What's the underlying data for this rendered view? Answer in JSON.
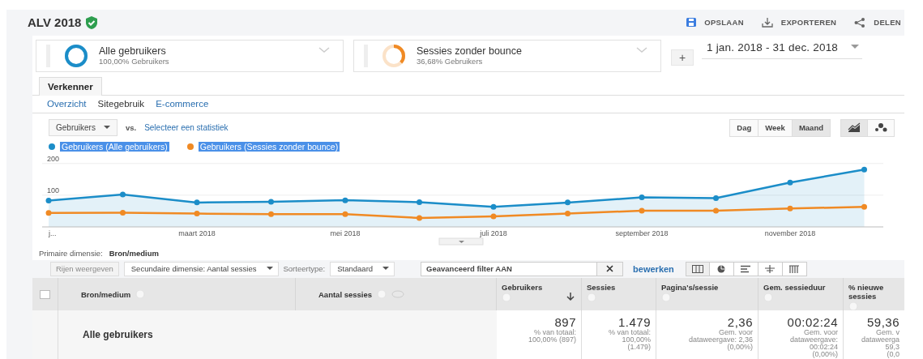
{
  "report": {
    "title": "ALV 2018",
    "verified": true
  },
  "actions": [
    {
      "label": "OPSLAAN",
      "kind": "save"
    },
    {
      "label": "EXPORTEREN",
      "kind": "export"
    },
    {
      "label": "DELEN",
      "kind": "share"
    }
  ],
  "segments": [
    {
      "name": "Alle gebruikers",
      "share": "100,00% Gebruikers",
      "level": 1.0,
      "color": "#1b8dc8"
    },
    {
      "name": "Sessies zonder bounce",
      "share": "36,68% Gebruikers",
      "level": 0.3668,
      "color": "#f08a24"
    }
  ],
  "add_segment": "+",
  "date_range": "1 jan. 2018 - 31 dec. 2018",
  "tabs": [
    {
      "label": "Verkenner",
      "selected": true
    }
  ],
  "subtabs": [
    {
      "label": "Overzicht",
      "selected": false
    },
    {
      "label": "Sitegebruik",
      "selected": true
    },
    {
      "label": "E-commerce",
      "selected": false
    }
  ],
  "metric_select": "Gebruikers",
  "vs": "vs.",
  "compare_link": "Selecteer een statistiek",
  "periods": [
    {
      "label": "Dag",
      "selected": false
    },
    {
      "label": "Week",
      "selected": false
    },
    {
      "label": "Maand",
      "selected": true
    }
  ],
  "chart_types": [
    {
      "kind": "line",
      "selected": true
    },
    {
      "kind": "motion",
      "selected": false
    }
  ],
  "chart_data": {
    "type": "area",
    "categories": [
      "j...",
      null,
      "maart 2018",
      null,
      "mei 2018",
      null,
      "juli 2018",
      null,
      "september 2018",
      null,
      "november 2018",
      null
    ],
    "ylim": [
      0,
      276
    ],
    "yticks": [
      100,
      200
    ],
    "series": [
      {
        "name": "Gebruikers (Alle gebruikers)",
        "color": "#1b8dc8",
        "marker": true,
        "values": [
          83,
          102,
          77,
          79,
          84,
          78,
          63,
          77,
          93,
          91,
          140,
          181
        ]
      },
      {
        "name": "Gebruikers (Sessies zonder bounce)",
        "color": "#f08a24",
        "type": "line",
        "marker": true,
        "values": [
          44,
          45,
          42,
          40,
          40,
          28,
          33,
          42,
          51,
          51,
          58,
          63
        ]
      }
    ]
  },
  "primary_dimension": {
    "label": "Primaire dimensie:",
    "value": "Bron/medium"
  },
  "toolbar": {
    "show_rows": {
      "label": "Rijen weergeven",
      "disabled": true
    },
    "secondary": "Secundaire dimensie: Aantal sessies",
    "sort_label": "Sorteertype:",
    "sort_value": "Standaard",
    "filter": "Geavanceerd filter AAN",
    "edit": "bewerken",
    "views": [
      {
        "kind": "table",
        "selected": true
      },
      {
        "kind": "pie",
        "selected": false
      },
      {
        "kind": "bar",
        "selected": false
      },
      {
        "kind": "comparison",
        "selected": false
      },
      {
        "kind": "pivot",
        "selected": false
      }
    ]
  },
  "table": {
    "select_all": {
      "checked": false
    },
    "columns": [
      {
        "label": "Bron/medium",
        "kind": "dimension",
        "help": true,
        "sorted": false
      },
      {
        "label": "Aantal sessies",
        "kind": "secondary",
        "help": true,
        "sorted": false
      },
      {
        "label": "Gebruikers",
        "kind": "metric",
        "help": true,
        "sorted": true
      },
      {
        "label": "Sessies",
        "kind": "metric",
        "help": true,
        "sorted": false
      },
      {
        "label": "Pagina's/sessie",
        "kind": "metric",
        "help": true,
        "sorted": false
      },
      {
        "label": "Gem. sessieduur",
        "kind": "metric",
        "help": true,
        "sorted": false
      },
      {
        "label": "% nieuwe sessies",
        "kind": "metric",
        "help": true,
        "sorted": false
      }
    ],
    "rows": [
      {
        "cells": [
          {
            "value": "Alle gebruikers"
          },
          {},
          {
            "value": "897",
            "note": [
              "% van totaal:",
              "100,00% (897)"
            ]
          },
          {
            "value": "1.479",
            "note": [
              "% van totaal:",
              "100,00%",
              "(1.479)"
            ]
          },
          {
            "value": "2,36",
            "note": [
              "Gem. voor",
              "dataweergave: 2,36",
              "(0,00%)"
            ]
          },
          {
            "value": "00:02:24",
            "note": [
              "Gem. voor",
              "dataweergave:",
              "00:02:24",
              "(0,00%)"
            ]
          },
          {
            "value": "59,36",
            "note": [
              "Gem. v",
              "dataweerga",
              "59,3",
              "(0,0"
            ]
          }
        ]
      }
    ]
  }
}
